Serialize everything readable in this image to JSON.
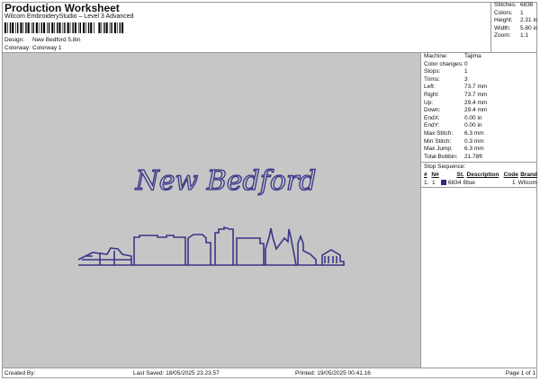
{
  "header": {
    "title": "Production Worksheet",
    "subtitle": "Wilcom EmbroideryStudio – Level 3 Advanced",
    "design_label": "Design:",
    "design_value": "New Bedford 5,8in",
    "colorway_label": "Colorway:",
    "colorway_value": "Colorway 1"
  },
  "stats": [
    {
      "k": "Stitches:",
      "v": "6836"
    },
    {
      "k": "Colors:",
      "v": "1"
    },
    {
      "k": "Height:",
      "v": "2.31 in"
    },
    {
      "k": "Width:",
      "v": "5.80 in"
    },
    {
      "k": "Zoom:",
      "v": "1:1"
    }
  ],
  "details": [
    {
      "k": "Machine:",
      "v": "Tajima"
    },
    {
      "k": "Color changes:",
      "v": "0"
    },
    {
      "k": "Stops:",
      "v": "1"
    },
    {
      "k": "Trims:",
      "v": "3"
    },
    {
      "k": "Left:",
      "v": "73.7 mm"
    },
    {
      "k": "Right:",
      "v": "73.7 mm"
    },
    {
      "k": "Up:",
      "v": "29.4 mm"
    },
    {
      "k": "Down:",
      "v": "29.4 mm"
    },
    {
      "k": "EndX:",
      "v": "0.00 in"
    },
    {
      "k": "EndY:",
      "v": "0.00 in"
    },
    {
      "k": "Max Stitch:",
      "v": "6.3 mm"
    },
    {
      "k": "Min Stitch:",
      "v": "0.3 mm"
    },
    {
      "k": "Max Jump:",
      "v": "6.3 mm"
    },
    {
      "k": "Total Bobbin:",
      "v": "21.78ft"
    }
  ],
  "stop_sequence": {
    "title": "Stop Sequence:",
    "columns": [
      "#",
      "N#",
      "St.",
      "Description",
      "Code",
      "Brand"
    ],
    "rows": [
      {
        "num": "1.",
        "n": "1",
        "st": "6834",
        "desc": "Blue",
        "code": "1",
        "brand": "Wilcom",
        "color": "#2e2a7a"
      }
    ]
  },
  "design": {
    "lettering": "New Bedford",
    "thread_color": "#3a3587"
  },
  "footer": {
    "created": "Created By:",
    "saved": "Last Saved: 18/05/2025 23.23.57",
    "printed": "Printed: 19/05/2025 00.41.16",
    "page": "Page 1 of 1"
  }
}
